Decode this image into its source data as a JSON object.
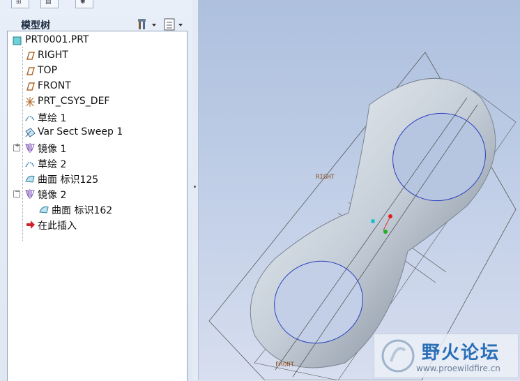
{
  "panel": {
    "title": "模型树",
    "tree": [
      {
        "label": "PRT0001.PRT",
        "icon": "part-icon"
      },
      {
        "label": "RIGHT",
        "icon": "datum-plane-icon"
      },
      {
        "label": "TOP",
        "icon": "datum-plane-icon"
      },
      {
        "label": "FRONT",
        "icon": "datum-plane-icon"
      },
      {
        "label": "PRT_CSYS_DEF",
        "icon": "coordinate-system-icon"
      },
      {
        "label": "草绘 1",
        "icon": "sketch-icon"
      },
      {
        "label": "Var Sect Sweep 1",
        "icon": "sweep-icon"
      },
      {
        "label": "镜像 1",
        "icon": "mirror-icon",
        "collapsed": true
      },
      {
        "label": "草绘 2",
        "icon": "sketch-icon"
      },
      {
        "label": "曲面 标识125",
        "icon": "surface-icon"
      },
      {
        "label": "镜像 2",
        "icon": "mirror-icon",
        "expanded": true
      },
      {
        "label": "曲面 标识162",
        "icon": "surface-icon",
        "child": true
      },
      {
        "label": "在此插入",
        "icon": "insert-here-arrow-icon"
      }
    ]
  },
  "viewport": {
    "label_right": "RIGHT",
    "label_front": "FRONT"
  },
  "watermark": {
    "title": "野火论坛",
    "url": "www.proewildfire.cn"
  },
  "colors": {
    "model": "#c8d2dc",
    "datum_plane": "#b06a2a",
    "insert_arrow": "#d0202a"
  }
}
